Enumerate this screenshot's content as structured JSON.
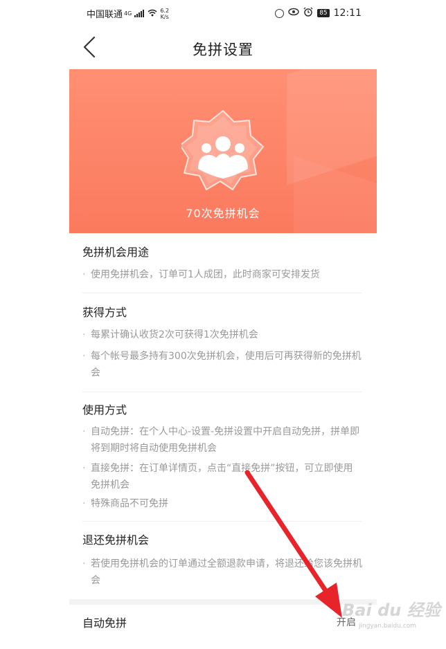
{
  "status_bar": {
    "carrier": "中国联通",
    "network": "4G",
    "speed_value": "6.2",
    "speed_unit": "K/s",
    "battery": "85",
    "time": "12:11"
  },
  "header": {
    "title": "免拼设置",
    "back_icon": "chevron-left-icon"
  },
  "banner": {
    "caption": "70次免拼机会",
    "gradient_top": "#ff8f73",
    "gradient_bottom": "#fb7a5e",
    "badge_icon": "group-users-badge-icon"
  },
  "sections": [
    {
      "title": "免拼机会用途",
      "items": [
        "使用免拼机会，订单可1人成团，此时商家可安排发货"
      ]
    },
    {
      "title": "获得方式",
      "items": [
        "每累计确认收货2次可获得1次免拼机会",
        "每个帐号最多持有300次免拼机会，使用后可再获得新的免拼机会"
      ]
    },
    {
      "title": "使用方式",
      "items": [
        "自动免拼：在个人中心-设置-免拼设置中开启自动免拼，拼单即将到期时将自动使用免拼机会",
        "直接免拼：在订单详情页，点击“直接免拼”按钮，可立即使用免拼机会",
        "特殊商品不可免拼"
      ]
    },
    {
      "title": "退还免拼机会",
      "items": [
        "若使用免拼机会的订单通过全额退款申请，将退还给您该免拼机会"
      ]
    }
  ],
  "auto_setting": {
    "label": "自动免拼",
    "value": "开启"
  },
  "watermark": {
    "brand": "Bai du 经验",
    "url": "jingyan.baidu.com"
  },
  "annotation": {
    "arrow_color": "#e8242b"
  }
}
